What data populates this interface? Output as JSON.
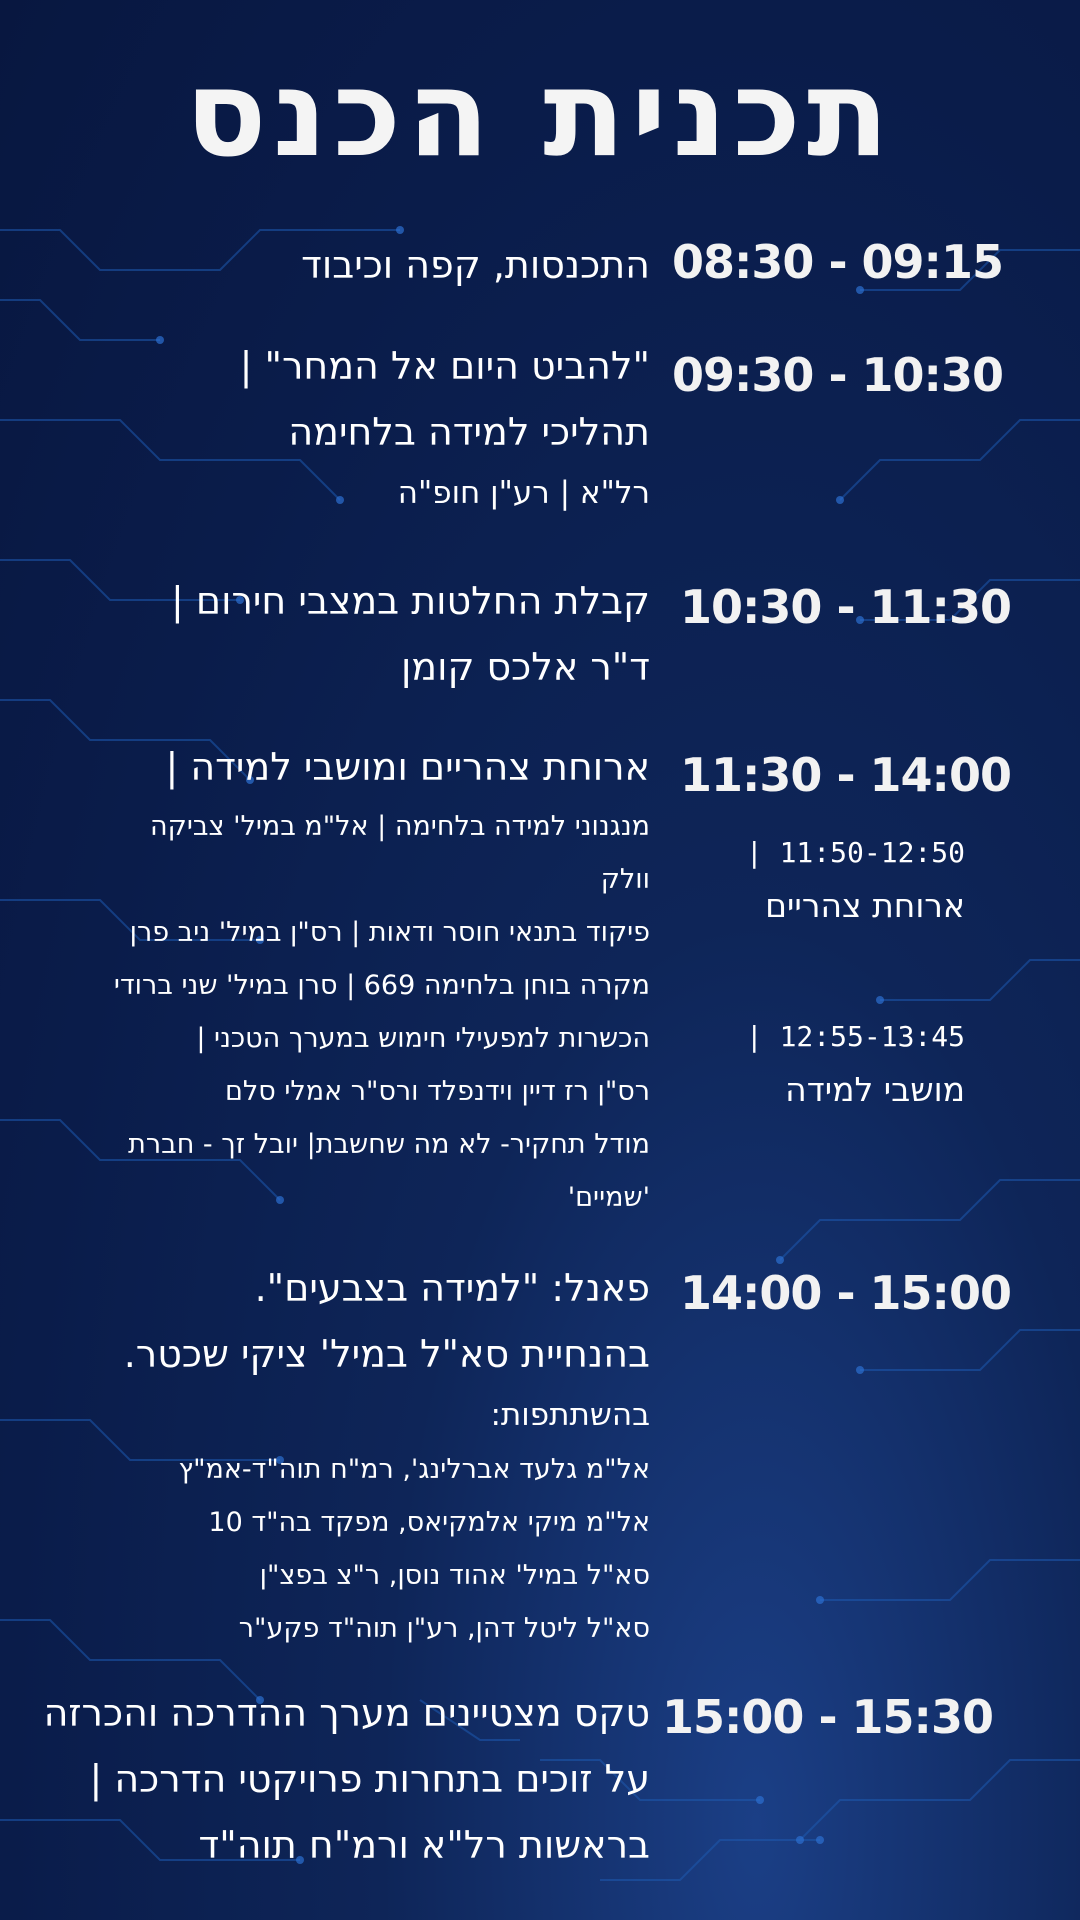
{
  "title": "תכנית הכנס",
  "schedule": [
    {
      "time": "08:30 - 09:15",
      "lines": [
        "התכנסות, קפה וכיבוד"
      ]
    },
    {
      "time": "09:30 - 10:30",
      "lines": [
        "\"להביט היום אל המחר\" |",
        "תהליכי למידה בלחימה",
        "רל\"א | רע\"ן חופ\"ה"
      ]
    },
    {
      "time": "10:30 - 11:30",
      "lines": [
        "קבלת החלטות במצבי חירום |",
        "ד\"ר אלכס קומן"
      ]
    },
    {
      "time": "11:30 - 14:00",
      "lines": [
        "ארוחת צהריים ומושבי למידה |",
        "מנגנוני למידה בלחימה | אל\"מ במיל' צביקה",
        "וולק",
        "פיקוד בתנאי חוסר ודאות | רס\"ן במיל' ניב פרן",
        "מקרה בוחן בלחימה 669 | סרן במיל' שני ברודי",
        " הכשרות למפעילי חימוש במערך הטכני |",
        "רס\"ן רז דיין וידנפלד ורס\"ר אמלי סלם",
        "מודל תחקיר- לא מה שחשבת| יובל זך - חברת",
        "'שמיים'"
      ]
    },
    {
      "time": "14:00 - 15:00",
      "lines": [
        "פאנל: \"למידה בצבעים\".",
        "בהנחיית סא\"ל במיל' ציקי שכטר.",
        "בהשתתפות:",
        "אל\"מ גלעד אברלינג', רמ\"ח תוה\"ד-אמ\"ץ",
        "אל\"מ מיקי אלמקיאס, מפקד בה\"ד 10",
        "סא\"ל במיל' אהוד נוסן, ר\"צ בפצ\"ן",
        "סא\"ל ליטל דהן, רע\"ן תוה\"ד פקע\"ר"
      ]
    },
    {
      "time": "15:00 - 15:30",
      "lines": [
        "טקס מצטיינים מערך ההדרכה והכרזה",
        "על זוכים בתחרות פרויקטי הדרכה |",
        "בראשות רל\"א ורמ\"ח תוה\"ד"
      ]
    }
  ],
  "side_sessions": [
    {
      "time": "11:50-12:50 |",
      "label": "ארוחת צהריים"
    },
    {
      "time": "12:55-13:45 |",
      "label": "מושבי למידה"
    }
  ],
  "colors": {
    "background": "#0b1f4f",
    "circuit": "#1e5ab0",
    "text": "#ffffff"
  }
}
